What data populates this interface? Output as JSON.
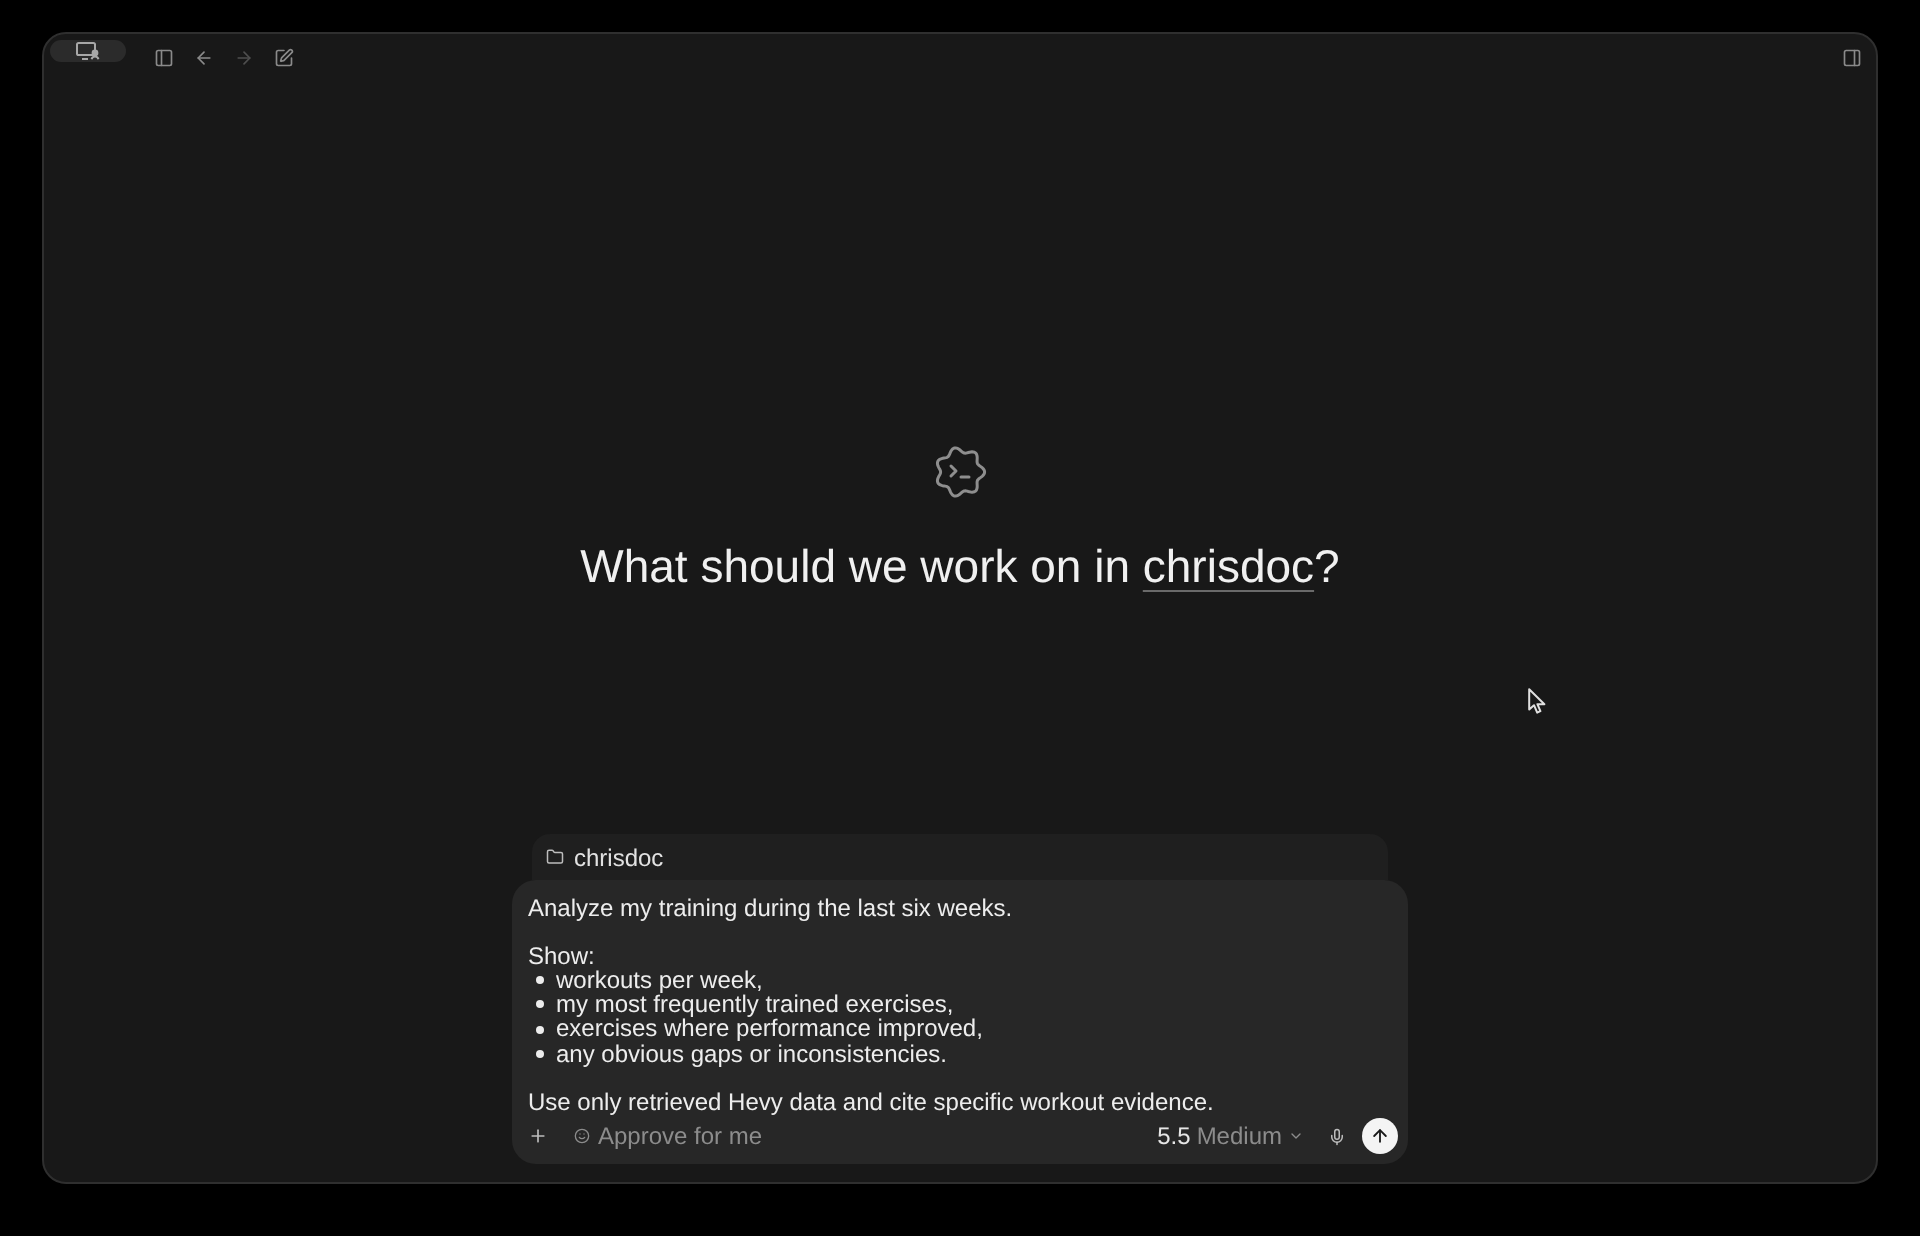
{
  "toolbar": {
    "back": {
      "disabled": false
    },
    "forward": {
      "disabled": true
    }
  },
  "heading": {
    "text": "What should we work on in ",
    "project": "chrisdoc",
    "suffix": "?"
  },
  "composer": {
    "folder": "chrisdoc",
    "prompt": [
      {
        "text": "Analyze my training during the last six weeks."
      },
      {
        "text": "Show:",
        "bullets": [
          "workouts per week,",
          "my most frequently trained exercises,",
          "exercises where performance improved,",
          "any obvious gaps or inconsistencies."
        ]
      },
      {
        "text": "Use only retrieved Hevy data and cite specific workout evidence."
      }
    ],
    "approval": "Approve for me",
    "model": {
      "version": "5.5",
      "effort": "Medium"
    }
  }
}
